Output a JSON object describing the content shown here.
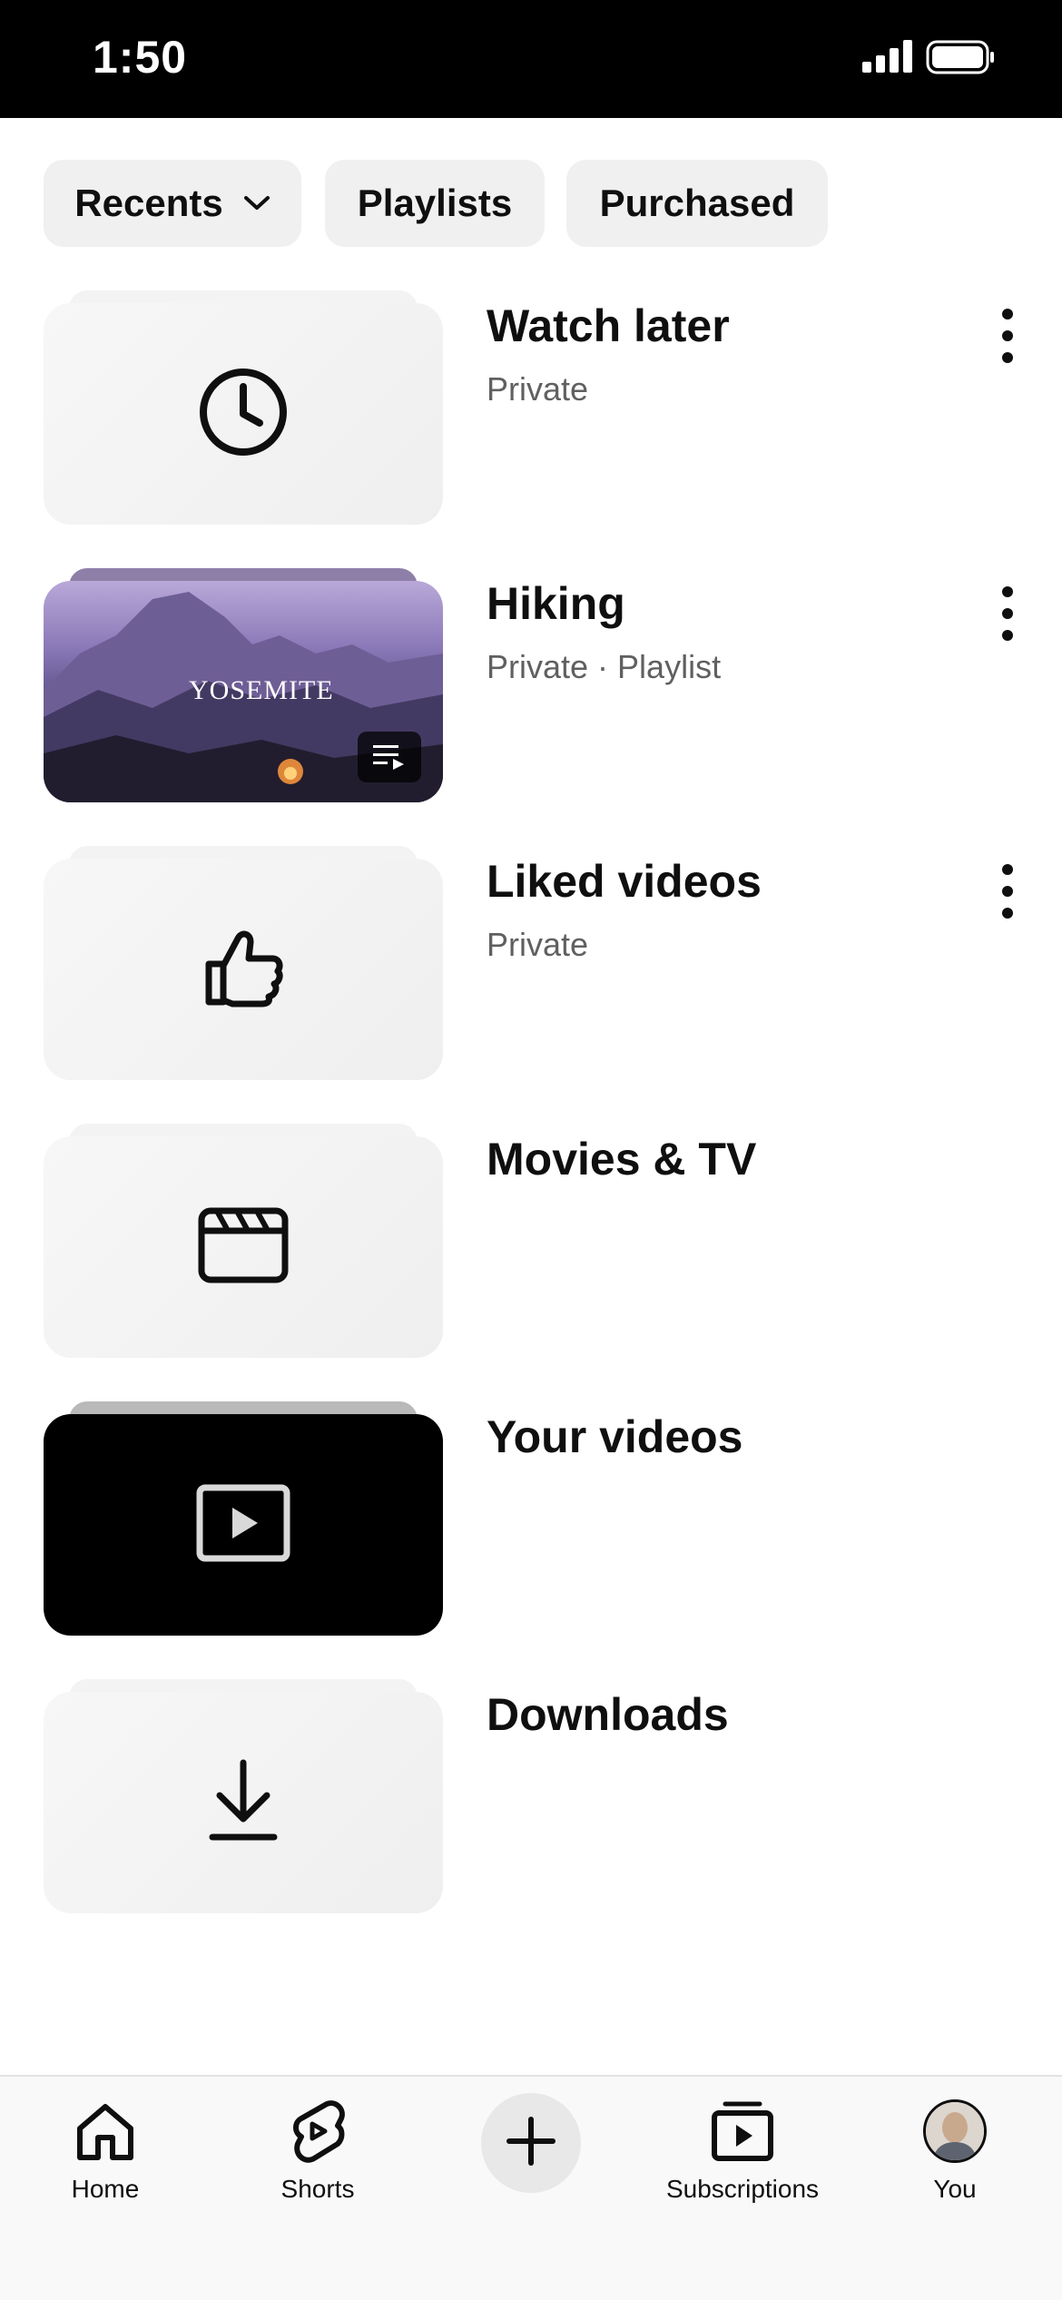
{
  "status_bar": {
    "time": "1:50"
  },
  "chips": [
    {
      "label": "Recents",
      "has_dropdown": true
    },
    {
      "label": "Playlists"
    },
    {
      "label": "Purchased"
    }
  ],
  "library_items": [
    {
      "title": "Watch later",
      "subtitle": "Private",
      "icon": "clock-icon",
      "has_menu": true
    },
    {
      "title": "Hiking",
      "subtitle": "Private · Playlist",
      "thumbnail_text": "YOSEMITE",
      "icon": "playlist-icon",
      "has_menu": true
    },
    {
      "title": "Liked videos",
      "subtitle": "Private",
      "icon": "thumbs-up-icon",
      "has_menu": true
    },
    {
      "title": "Movies & TV",
      "subtitle": "",
      "icon": "clapperboard-icon",
      "has_menu": false
    },
    {
      "title": "Your videos",
      "subtitle": "",
      "icon": "play-box-icon",
      "has_menu": false
    },
    {
      "title": "Downloads",
      "subtitle": "",
      "icon": "download-icon",
      "has_menu": false
    }
  ],
  "bottom_nav": [
    {
      "label": "Home",
      "icon": "home-icon"
    },
    {
      "label": "Shorts",
      "icon": "shorts-icon"
    },
    {
      "label": "",
      "icon": "plus-icon"
    },
    {
      "label": "Subscriptions",
      "icon": "subscriptions-icon"
    },
    {
      "label": "You",
      "icon": "avatar"
    }
  ],
  "colors": {
    "chip_bg": "#f0f0f0",
    "text_primary": "#0f0f0f",
    "text_secondary": "#606060",
    "status_bar_bg": "#000000"
  }
}
